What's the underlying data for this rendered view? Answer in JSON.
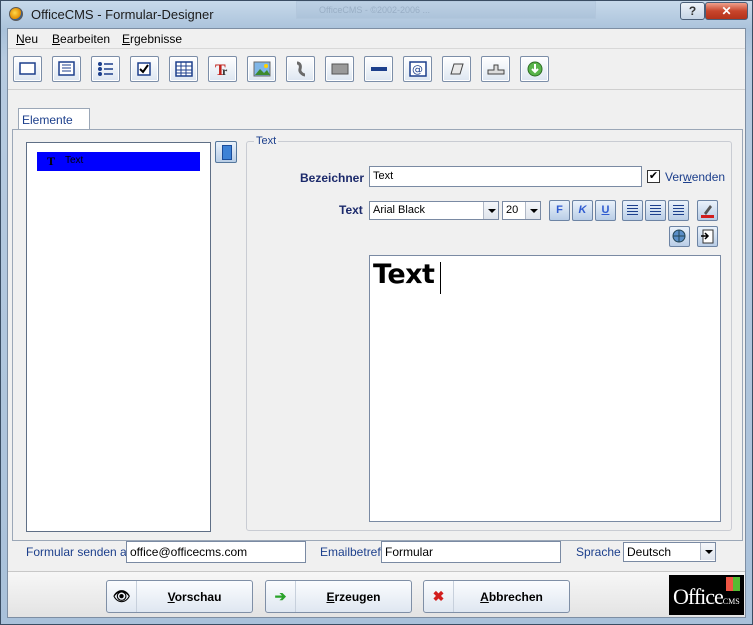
{
  "window": {
    "title": "OfficeCMS - Formular-Designer",
    "background_window_title": "OfficeCMS - ©2002-2006 ..."
  },
  "menu": [
    {
      "label": "Neu",
      "mnemonic": "N",
      "rest": "eu"
    },
    {
      "label": "Bearbeiten",
      "mnemonic": "B",
      "rest": "earbeiten"
    },
    {
      "label": "Ergebnisse",
      "mnemonic": "E",
      "rest": "rgebnisse"
    }
  ],
  "toolbar": [
    "textbox-icon",
    "multiline-icon",
    "list-icon",
    "checkbox-icon",
    "table-icon",
    "text-icon",
    "image-icon",
    "attachment-icon",
    "frame-icon",
    "separator-icon",
    "email-icon",
    "stamp-icon",
    "group-icon",
    "globe-icon"
  ],
  "tab": {
    "label": "Elemente"
  },
  "elements": [
    {
      "label": "Text",
      "icon": "T"
    }
  ],
  "group": {
    "legend": "Text"
  },
  "form": {
    "name_label": "Bezeichner",
    "name_value": "Text",
    "use_label_pre": "Ver",
    "use_label_ul": "w",
    "use_label_post": "enden",
    "use_checked": "✔",
    "text_label": "Text",
    "font": "Arial Black",
    "size": "20",
    "bold": "F",
    "italic": "K",
    "underline": "U",
    "editor_text": "Text"
  },
  "footer": {
    "send_label": "Formular senden an",
    "send_value": "office@officecms.com",
    "subject_label": "Emailbetreff",
    "subject_value": "Formular",
    "language_label": "Sprache",
    "language_value": "Deutsch"
  },
  "buttons": {
    "preview": {
      "ul": "V",
      "rest": "orschau"
    },
    "create": {
      "ul": "E",
      "rest": "rzeugen"
    },
    "cancel": {
      "ul": "A",
      "rest": "bbrechen"
    }
  },
  "logo": {
    "text": "Office",
    "sub": "CMS"
  },
  "colors": {
    "selection": "#0000ff",
    "label": "#1c2a6b",
    "accent": "#1c3f8c"
  }
}
